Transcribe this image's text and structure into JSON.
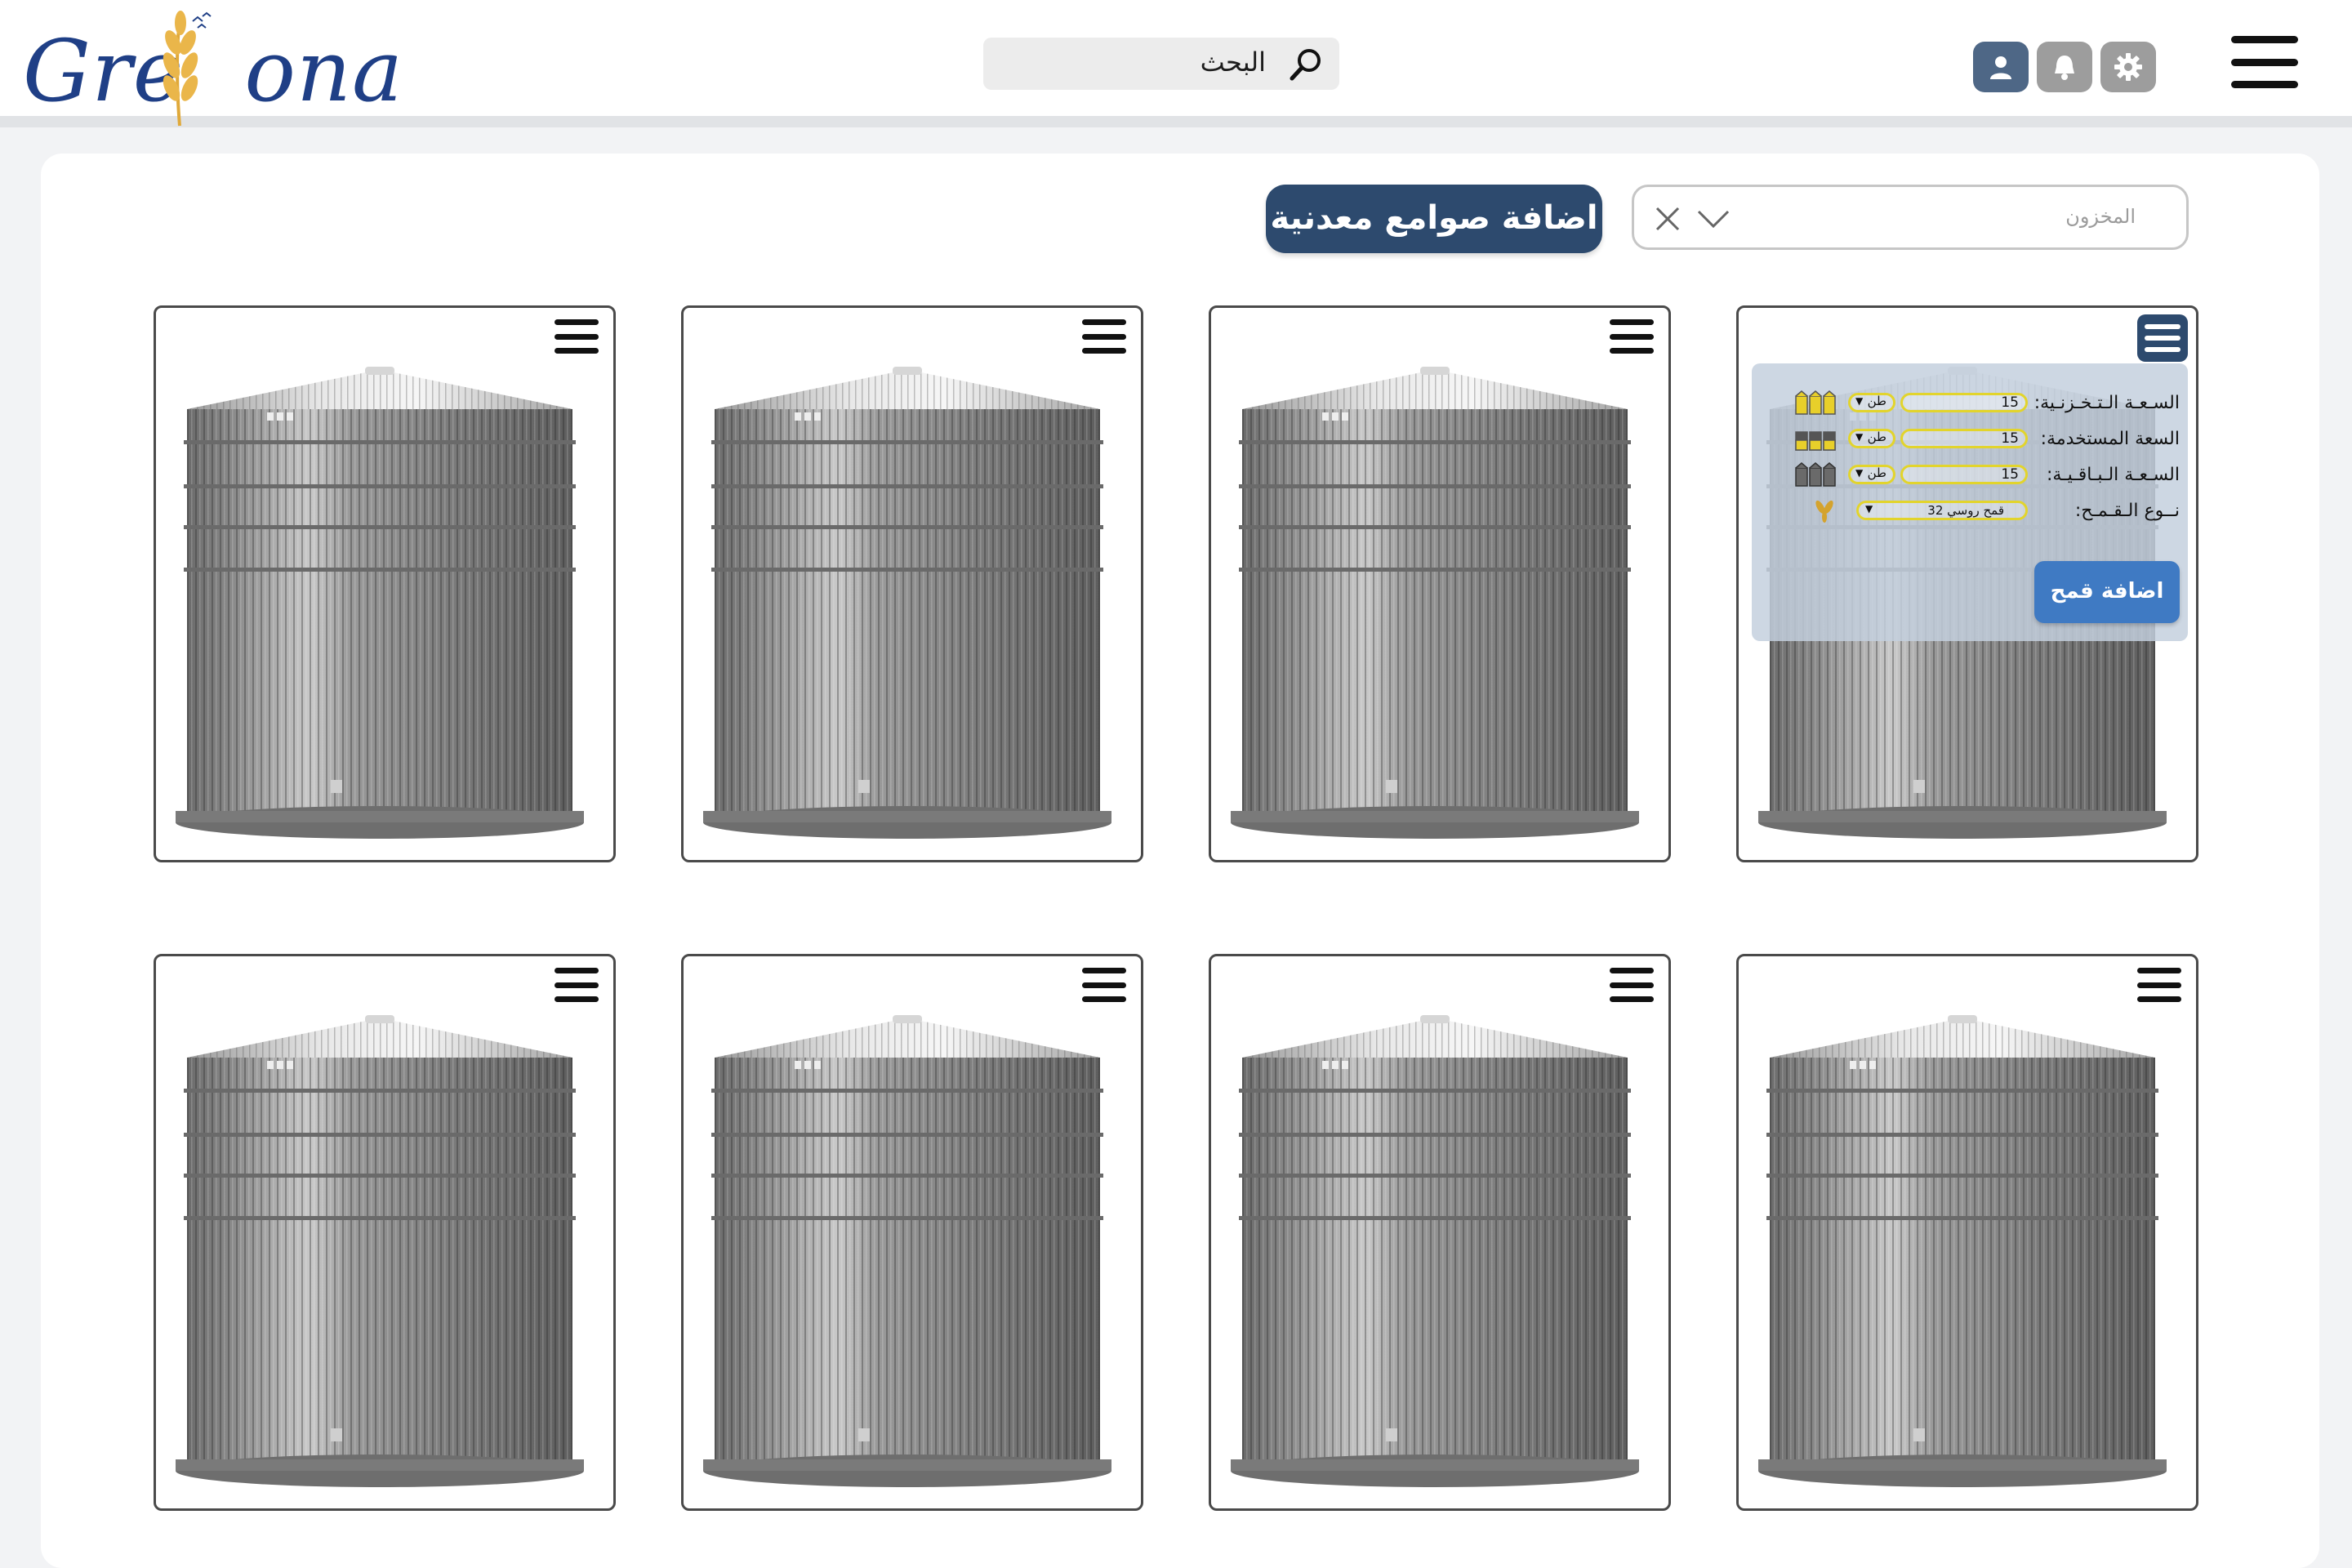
{
  "brand": {
    "logo_text_left": "Gre",
    "logo_text_right": "ona",
    "logo_accent": "#1f3f86"
  },
  "header": {
    "search_label": "البحث",
    "icons": [
      "search-icon",
      "user-icon",
      "bell-icon",
      "gear-icon",
      "hamburger-menu-icon"
    ]
  },
  "toolbar": {
    "add_silos_label": "اضافة صوامع معدنية",
    "filter_placeholder": "المخزون"
  },
  "silos": {
    "count": 8,
    "active_info": {
      "rows": [
        {
          "label": "السـعـة الـتـخـزنـية:",
          "value": "15",
          "unit": "طن",
          "icon": "full-silos-icon"
        },
        {
          "label": "السعة المستخدمة:",
          "value": "15",
          "unit": "طن",
          "icon": "partial-silos-icon"
        },
        {
          "label": "السـعـة الـبـاقـيـة:",
          "value": "15",
          "unit": "طن",
          "icon": "empty-silos-icon"
        },
        {
          "label": "نــوع الـقـمـح:",
          "value": "قمح روسي 32",
          "icon": "wheat-icon"
        }
      ],
      "add_wheat_label": "اضافة قمح"
    }
  },
  "colors": {
    "primary": "#2d4a6e",
    "button_blue": "#3f7ac3",
    "field_border": "#e2d42c"
  }
}
